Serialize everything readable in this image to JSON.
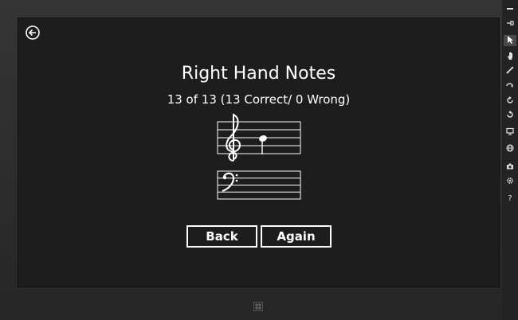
{
  "lesson": {
    "title": "Right Hand Notes",
    "progress": "13 of 13 (13 Correct/ 0 Wrong)"
  },
  "buttons": {
    "back_label": "Back",
    "again_label": "Again"
  },
  "icons": {
    "back": "back-arrow-icon",
    "start": "windows-logo-icon"
  },
  "toolbar": {
    "items": [
      "minimize-icon",
      "pin-icon",
      "pointer-icon",
      "hand-icon",
      "pen-icon",
      "swipe-icon",
      "rotate-clockwise-icon",
      "rotate-counterclockwise-icon",
      "monitor-icon",
      "globe-icon",
      "camera-icon",
      "settings-icon",
      "help-icon"
    ],
    "help_glyph": "?"
  },
  "colors": {
    "screen": "#1d1d1d",
    "text": "#ffffff",
    "bezel": "#2d2d2d"
  }
}
